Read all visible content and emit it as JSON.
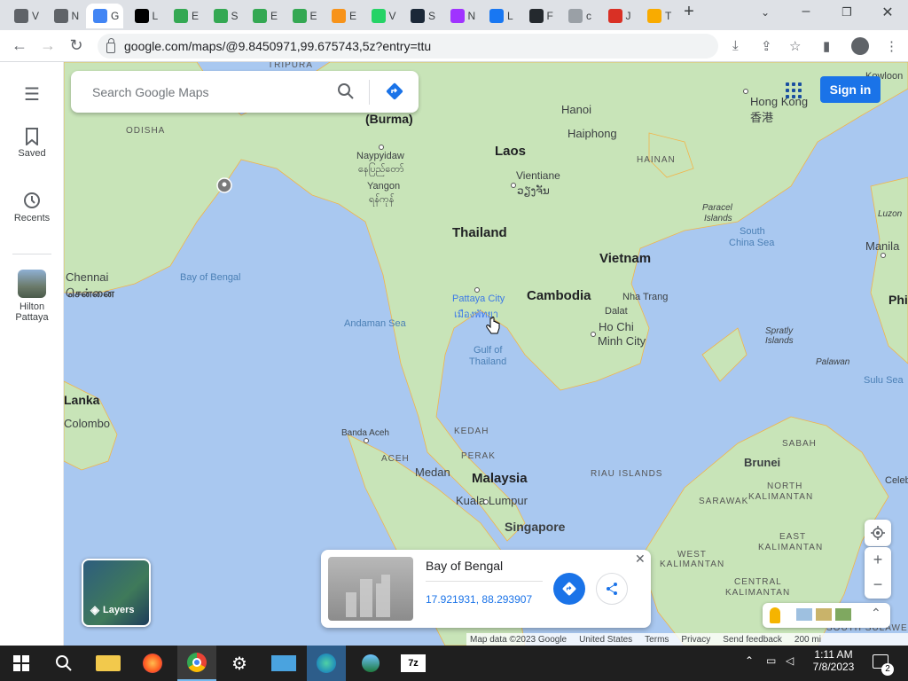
{
  "browser": {
    "tabs": [
      {
        "icon": "chrome-icon",
        "color": "#5f6368",
        "text": "V"
      },
      {
        "icon": "chrome-icon",
        "color": "#5f6368",
        "text": "N"
      },
      {
        "icon": "google-icon",
        "color": "#4285f4",
        "text": "G"
      },
      {
        "icon": "wikipedia-icon",
        "color": "#000000",
        "text": "L"
      },
      {
        "icon": "play-icon",
        "color": "#34a853",
        "text": "E"
      },
      {
        "icon": "play-icon",
        "color": "#34a853",
        "text": "S"
      },
      {
        "icon": "play-icon",
        "color": "#34a853",
        "text": "E"
      },
      {
        "icon": "play-icon",
        "color": "#34a853",
        "text": "E"
      },
      {
        "icon": "bitcoin-icon",
        "color": "#f7931a",
        "text": "E"
      },
      {
        "icon": "whatsapp-icon",
        "color": "#25d366",
        "text": "V"
      },
      {
        "icon": "steam-icon",
        "color": "#1b2838",
        "text": "S"
      },
      {
        "icon": "messenger-icon",
        "color": "#a033ff",
        "text": "N"
      },
      {
        "icon": "facebook-icon",
        "color": "#1877f2",
        "text": "L"
      },
      {
        "icon": "github-icon",
        "color": "#24292e",
        "text": "F"
      },
      {
        "icon": "globe-icon",
        "color": "#9aa0a6",
        "text": "c"
      },
      {
        "icon": "news-icon",
        "color": "#d93025",
        "text": "J"
      },
      {
        "icon": "mail-icon",
        "color": "#f9ab00",
        "text": "T"
      }
    ],
    "active_tab_text": "G",
    "url": "google.com/maps/@9.8450971,99.675743,5z?entry=ttu"
  },
  "sidebar": {
    "saved_label": "Saved",
    "recents_label": "Recents",
    "hilton_line1": "Hilton",
    "hilton_line2": "Pattaya"
  },
  "search": {
    "placeholder": "Search Google Maps"
  },
  "signin_label": "Sign in",
  "map_labels": {
    "tripura": "TRIPURA",
    "burma": "(Burma)",
    "odisha": "ODISHA",
    "naypyidaw": "Naypyidaw",
    "naypyidaw_local": "နေပြည်တော်",
    "yangon": "Yangon",
    "yangon_local": "ရန်ကုန်",
    "laos": "Laos",
    "vientiane": "Vientiane",
    "vientiane_local": "ວຽງຈັນ",
    "hanoi": "Hanoi",
    "haiphong": "Haiphong",
    "hainan": "HAINAN",
    "hongkong": "Hong Kong",
    "hongkong_local": "香港",
    "thailand": "Thailand",
    "vietnam": "Vietnam",
    "cambodia": "Cambodia",
    "pattaya": "Pattaya City",
    "pattaya_local": "เมืองพัทยา",
    "nhatrang": "Nha Trang",
    "dalat": "Dalat",
    "hochiminh1": "Ho Chi",
    "hochiminh2": "Minh City",
    "gulf1": "Gulf of",
    "gulf2": "Thailand",
    "andaman": "Andaman Sea",
    "bay": "Bay of Bengal",
    "chennai": "Chennai",
    "chennai_local": "சென்னை",
    "lanka": "Lanka",
    "colombo": "Colombo",
    "paracel1": "Paracel",
    "paracel2": "Islands",
    "southchina1": "South",
    "southchina2": "China Sea",
    "luzon": "Luzon",
    "manila": "Manila",
    "phil": "Phi",
    "spratly1": "Spratly",
    "spratly2": "Islands",
    "palawan": "Palawan",
    "sulu": "Sulu Sea",
    "bandaaceh": "Banda Aceh",
    "aceh": "ACEH",
    "kedah": "KEDAH",
    "perak": "PERAK",
    "medan": "Medan",
    "malaysia": "Malaysia",
    "kualalumpur": "Kuala Lumpur",
    "singapore": "Singapore",
    "riau": "RIAU ISLANDS",
    "brunei": "Brunei",
    "sabah": "SABAH",
    "nkal1": "NORTH",
    "nkal2": "KALIMANTAN",
    "sarawak": "SARAWAK",
    "ekal1": "EAST",
    "ekal2": "KALIMANTAN",
    "wkal1": "WEST",
    "wkal2": "KALIMANTAN",
    "ckal1": "CENTRAL",
    "ckal2": "KALIMANTAN",
    "skal": "SOUTH SULAWESI",
    "celeb": "Celeb",
    "kowloon": "Kowloon"
  },
  "place_card": {
    "title": "Bay of Bengal",
    "coords": "17.921931, 88.293907"
  },
  "layers_label": "Layers",
  "footer": {
    "mapdata": "Map data ©2023 Google",
    "region": "United States",
    "terms": "Terms",
    "privacy": "Privacy",
    "feedback": "Send feedback",
    "scale": "200 mi"
  },
  "taskbar": {
    "time": "1:11 AM",
    "date": "7/8/2023",
    "notif_count": "2"
  },
  "colors": {
    "accent": "#1a73e8",
    "land": "#c5e3b4",
    "water": "#a9c8f0"
  }
}
